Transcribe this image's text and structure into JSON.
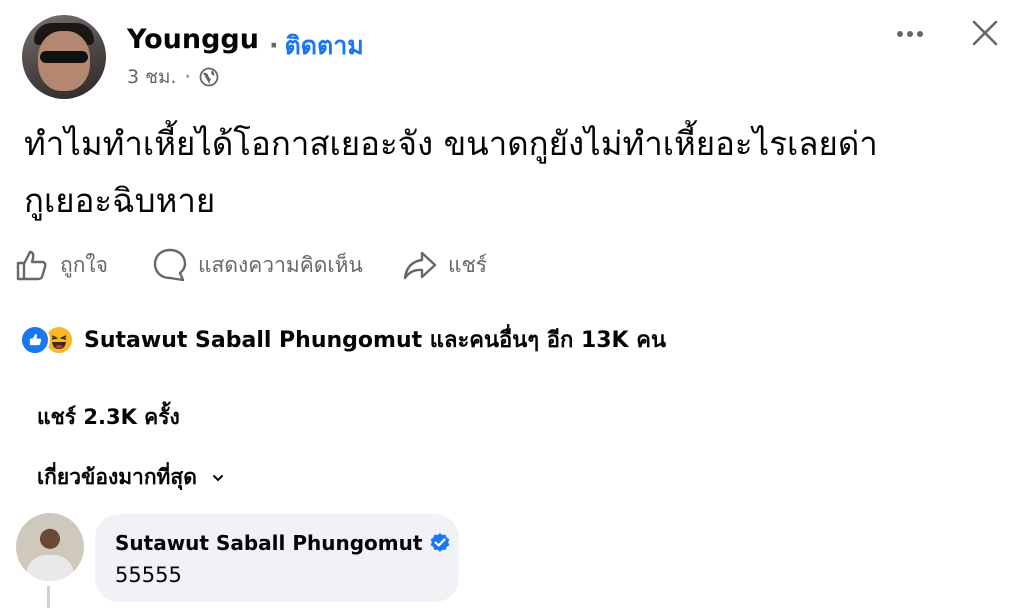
{
  "post": {
    "author": "Younggu",
    "follow_label": "ติดตาม",
    "separator": "·",
    "time": "3 ชม.",
    "meta_separator": "·",
    "text_line1": "ทำไมทำเหี้ยได้โอกาสเยอะจัง ขนาดกูยังไม่ทำเหี้ยอะไรเลยด่า",
    "text_line2": "กูเยอะฉิบหาย"
  },
  "actions": {
    "like_label": "ถูกใจ",
    "comment_label": "แสดงความคิดเห็น",
    "share_label": "แชร์"
  },
  "reactions_summary": "Sutawut Saball Phungomut และคนอื่นๆ อีก 13K คน",
  "shares_count": "แชร์ 2.3K ครั้ง",
  "sort_label": "เกี่ยวข้องมากที่สุด",
  "comment": {
    "author": "Sutawut Saball Phungomut",
    "text": "55555"
  },
  "colors": {
    "link_blue": "#1877f2",
    "secondary_text": "#65676b",
    "bubble_bg": "#f0f2f5",
    "haha_yellow": "#f7b928"
  },
  "icons": [
    "globe-icon",
    "more-icon",
    "close-icon",
    "like-icon",
    "comment-icon",
    "share-icon",
    "chevron-down-icon",
    "verified-badge-icon"
  ]
}
